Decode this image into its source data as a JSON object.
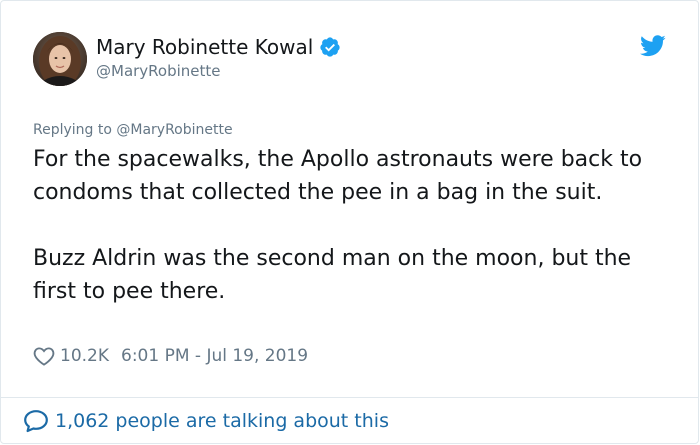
{
  "author": {
    "display_name": "Mary Robinette Kowal",
    "handle": "@MaryRobinette",
    "verified": true
  },
  "reply_context": {
    "text": "Replying to @MaryRobinette"
  },
  "tweet": {
    "paragraph_1": "For the spacewalks, the Apollo astronauts were back to condoms that collected the pee in a bag in the suit.",
    "paragraph_2": "Buzz Aldrin was the second man on the moon, but the first to pee there."
  },
  "meta": {
    "likes": "10.2K",
    "timestamp": "6:01 PM - Jul 19, 2019"
  },
  "footer": {
    "talking_label": "1,062 people are talking about this"
  },
  "icons": {
    "verified": "verified-badge-icon",
    "brand": "twitter-bird-icon",
    "like": "heart-outline-icon",
    "conversation": "speech-bubble-icon"
  },
  "colors": {
    "twitter_blue": "#1da1f2",
    "link_blue": "#1b6aa6",
    "secondary_text": "#657786",
    "primary_text": "#14171a",
    "border": "#e1e8ed"
  }
}
